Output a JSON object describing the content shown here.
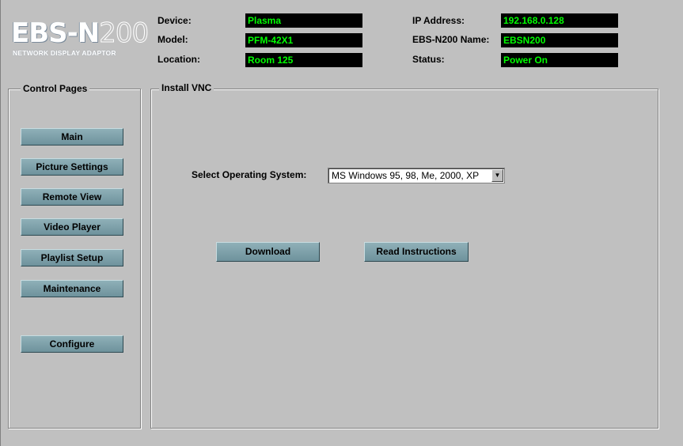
{
  "logo": {
    "main_bold": "EBS-N",
    "main_thin": "200",
    "subtitle": "NETWORK DISPLAY ADAPTOR"
  },
  "info": {
    "device": {
      "label": "Device:",
      "value": "Plasma"
    },
    "model": {
      "label": "Model:",
      "value": "PFM-42X1"
    },
    "location": {
      "label": "Location:",
      "value": "Room 125"
    },
    "ip": {
      "label": "IP Address:",
      "value": "192.168.0.128"
    },
    "name": {
      "label": "EBS-N200 Name:",
      "value": "EBSN200"
    },
    "status": {
      "label": "Status:",
      "value": "Power On"
    }
  },
  "sidebar": {
    "title": "Control Pages",
    "items": [
      {
        "label": "Main"
      },
      {
        "label": "Picture Settings"
      },
      {
        "label": "Remote View"
      },
      {
        "label": "Video Player"
      },
      {
        "label": "Playlist Setup"
      },
      {
        "label": "Maintenance"
      },
      {
        "label": "Configure"
      }
    ]
  },
  "main": {
    "title": "Install VNC",
    "os_label": "Select Operating System:",
    "os_selected": "MS Windows 95, 98, Me, 2000, XP",
    "download_label": "Download",
    "instructions_label": "Read Instructions"
  },
  "colors": {
    "value_bg": "#000000",
    "value_text": "#00ff00",
    "button": "#7fa2ab",
    "background": "#c0c0c0"
  },
  "icons": {
    "dropdown": "chevron-down-icon"
  }
}
